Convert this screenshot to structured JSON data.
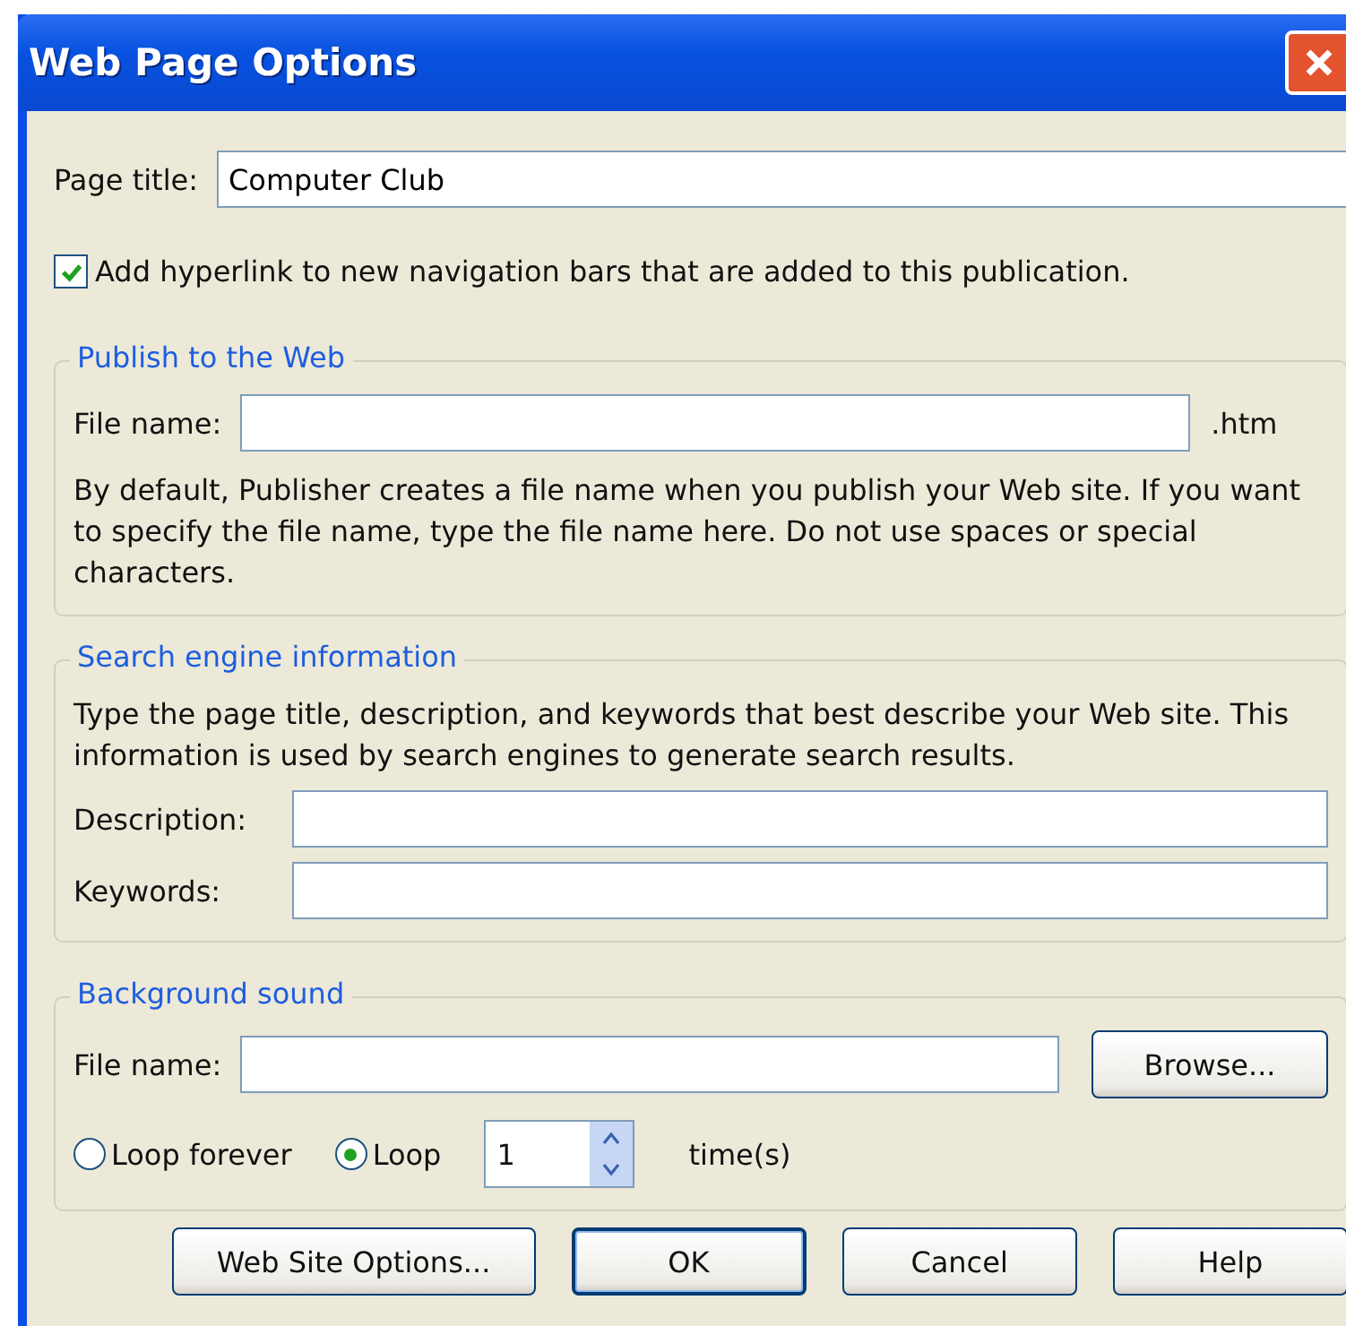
{
  "window": {
    "title": "Web Page Options"
  },
  "page_title": {
    "label": "Page title:",
    "value": "Computer Club"
  },
  "hyperlink_option": {
    "label": "Add hyperlink to new navigation bars that are added to this publication.",
    "checked": true
  },
  "publish": {
    "title": "Publish to the Web",
    "file_label": "File name:",
    "suffix": ".htm",
    "note": "By default, Publisher creates a file name when you publish your Web site. If you want to specify the file name, type the file name here. Do not use spaces or special characters."
  },
  "search_engine": {
    "title": "Search engine information",
    "note": "Type the page title, description, and keywords that best describe your Web site. This information is used by search engines to generate search results.",
    "fields": [
      {
        "label": "Description:"
      },
      {
        "label": "Keywords:"
      }
    ]
  },
  "background_sound": {
    "title": "Background sound",
    "file_label": "File name:",
    "browse": "Browse...",
    "loop_options": [
      {
        "label": "Loop forever",
        "selected": false
      },
      {
        "label": "Loop",
        "selected": true
      }
    ],
    "count": "1",
    "count_unit": "time(s)"
  },
  "buttons": [
    {
      "label": "Web Site Options...",
      "default": false
    },
    {
      "label": "OK",
      "default": true
    },
    {
      "label": "Cancel",
      "default": false
    },
    {
      "label": "Help",
      "default": false
    }
  ]
}
